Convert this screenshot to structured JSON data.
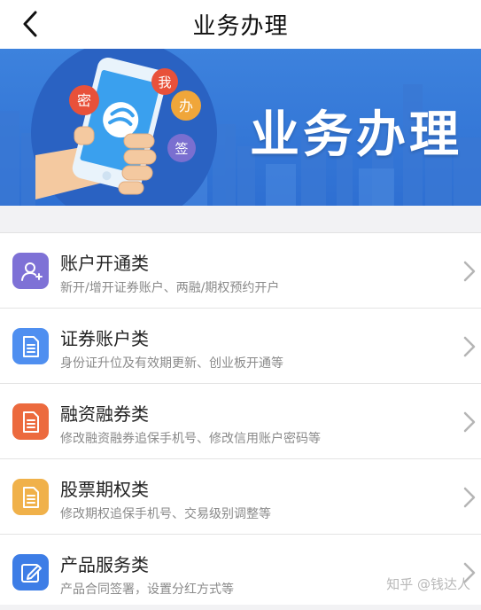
{
  "header": {
    "title": "业务办理",
    "back_icon": "back-chevron-icon"
  },
  "banner": {
    "title": "业务办理",
    "bubbles": [
      "密",
      "我",
      "办",
      "签"
    ],
    "colors": {
      "background": "#2e6fd2",
      "circle": "#2a62c2",
      "bubble_red": "#e8513a",
      "bubble_orange": "#f0a63a",
      "bubble_purple": "#7a6fd0",
      "phone_screen": "#3aa0ee"
    }
  },
  "list": {
    "items": [
      {
        "title": "账户开通类",
        "subtitle": "新开/增开证券账户、两融/期权预约开户",
        "icon": "user-add-icon",
        "color": "#7e71d6"
      },
      {
        "title": "证券账户类",
        "subtitle": "身份证升位及有效期更新、创业板开通等",
        "icon": "document-icon",
        "color": "#4f8ff0"
      },
      {
        "title": "融资融券类",
        "subtitle": "修改融资融券追保手机号、修改信用账户密码等",
        "icon": "document-icon",
        "color": "#ec6a3e"
      },
      {
        "title": "股票期权类",
        "subtitle": "修改期权追保手机号、交易级别调整等",
        "icon": "document-icon",
        "color": "#f0b14a"
      },
      {
        "title": "产品服务类",
        "subtitle": "产品合同签署，设置分红方式等",
        "icon": "edit-icon",
        "color": "#3d7de6"
      }
    ]
  },
  "watermark": "知乎 @钱达人"
}
